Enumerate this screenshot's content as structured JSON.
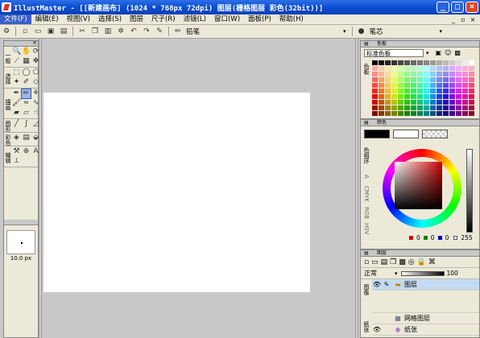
{
  "window": {
    "title": "IllustMaster - [[新建画布] (1024 * 768px 72dpi)    图层(栅格图层 彩色(32bit))]",
    "minimize": "_",
    "maximize": "□",
    "close": "×"
  },
  "menu": {
    "items": [
      "文件(F)",
      "编辑(E)",
      "视图(V)",
      "选择(S)",
      "图层",
      "尺子(R)",
      "滤镜(L)",
      "窗口(W)",
      "面板(P)",
      "帮助(H)"
    ],
    "mdi": [
      "_",
      "▫",
      "×"
    ]
  },
  "toolbar": {
    "brush_label": "铅笔",
    "brush_dropdown": "▾",
    "core_label": "笔芯",
    "core_dropdown": "▾"
  },
  "tools": {
    "panel_close": "×",
    "group_labels": [
      "一般",
      "选择",
      "描画",
      "图形",
      "彩色",
      "编辑"
    ],
    "brush_size": "10.0 px"
  },
  "swatches": {
    "panel_title": "色板",
    "selected": "标准色板",
    "side_label": "色板"
  },
  "color": {
    "panel_title": "颜色",
    "side_label": "色相环",
    "side_tabs": [
      "A",
      "CMYK",
      "RGB",
      "HSV"
    ],
    "r": "0",
    "g": "0",
    "b": "0",
    "value": "255",
    "fg": "#000000",
    "bg": "#ffffff"
  },
  "layers": {
    "panel_title": "图层",
    "blend_mode": "正常",
    "opacity": "100",
    "side_label": "图像",
    "side_label2": "纸张",
    "items": [
      {
        "name": "图层"
      },
      {
        "name": "网格图层"
      },
      {
        "name": "纸张"
      }
    ]
  }
}
